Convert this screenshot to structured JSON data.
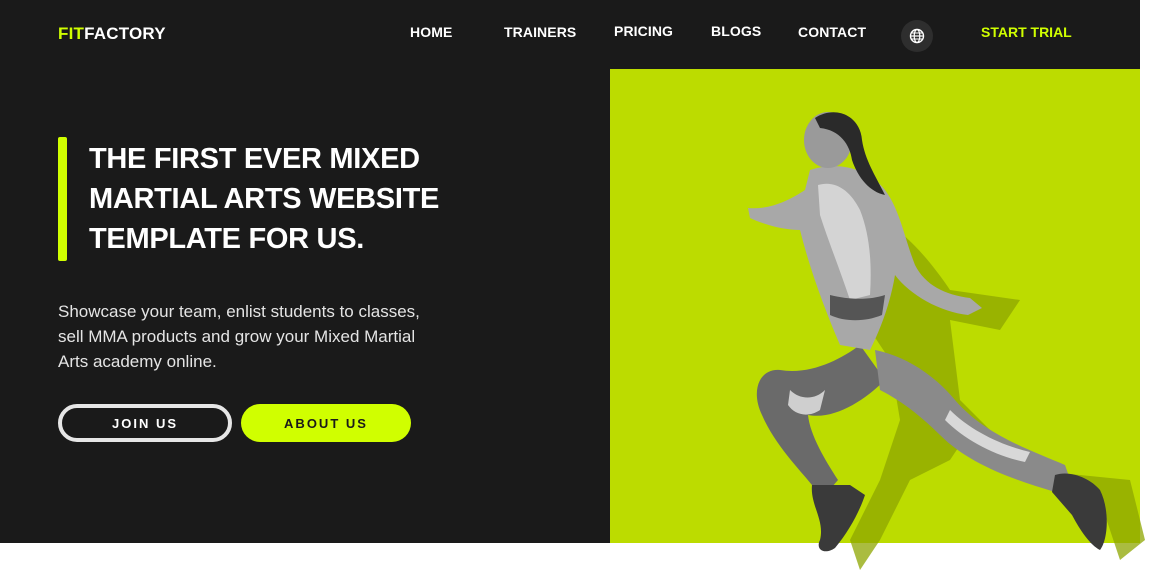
{
  "brand": {
    "logo_accent": "FIT",
    "logo_rest": "FACTORY",
    "accent_color": "#d0ff00",
    "dark_color": "#1a1a1a",
    "panel_color": "#bcdc00"
  },
  "nav": {
    "items": [
      {
        "label": "HOME"
      },
      {
        "label": "TRAINERS"
      },
      {
        "label": "PRICING"
      },
      {
        "label": "BLOGS"
      },
      {
        "label": "CONTACT"
      }
    ],
    "language_icon": "globe-icon",
    "cta_label": "START TRIAL"
  },
  "hero": {
    "title": "THE FIRST EVER MIXED\nMARTIAL ARTS WEBSITE\nTEMPLATE FOR US.",
    "description": "Showcase your team, enlist students to classes,\nsell MMA products and grow your Mixed Martial\nArts academy online.",
    "join_label": "JOIN US",
    "about_label": "ABOUT US"
  }
}
